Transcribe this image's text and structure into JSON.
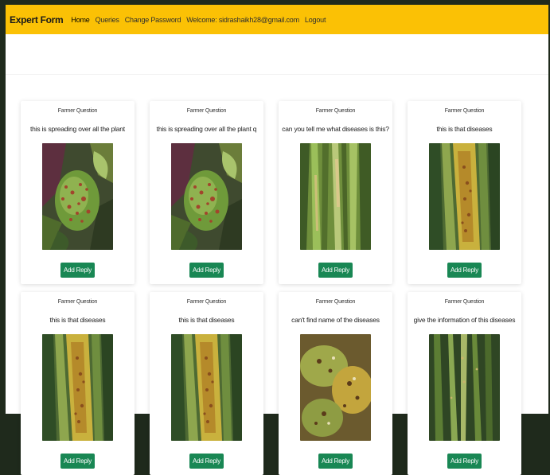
{
  "navbar": {
    "brand": "Expert Form",
    "links": [
      "Home",
      "Queries",
      "Change Password",
      "Welcome: sidrashaikh28@gmail.com",
      "Logout"
    ]
  },
  "cards": [
    {
      "header": "Farmer Question",
      "question": "this is spreading over all the plant",
      "image": "spotted-fruit-leaf",
      "button": "Add Reply"
    },
    {
      "header": "Farmer Question",
      "question": "this is spreading over all the plant q",
      "image": "spotted-fruit-leaf",
      "button": "Add Reply"
    },
    {
      "header": "Farmer Question",
      "question": "can you tell me what diseases is this?",
      "image": "green-grass-blades",
      "button": "Add Reply"
    },
    {
      "header": "Farmer Question",
      "question": "this is that diseases",
      "image": "rust-leaf",
      "button": "Add Reply"
    },
    {
      "header": "Farmer Question",
      "question": "this is that diseases",
      "image": "rust-leaf",
      "button": "Add Reply"
    },
    {
      "header": "Farmer Question",
      "question": "this is that diseases",
      "image": "rust-leaf",
      "button": "Add Reply"
    },
    {
      "header": "Farmer Question",
      "question": "can't find name of the diseases",
      "image": "spotted-leaves",
      "button": "Add Reply"
    },
    {
      "header": "Farmer Question",
      "question": "give the information of this diseases",
      "image": "dark-grass-blades",
      "button": "Add Reply"
    }
  ],
  "colors": {
    "navbar": "#fbc105",
    "button": "#198754"
  }
}
